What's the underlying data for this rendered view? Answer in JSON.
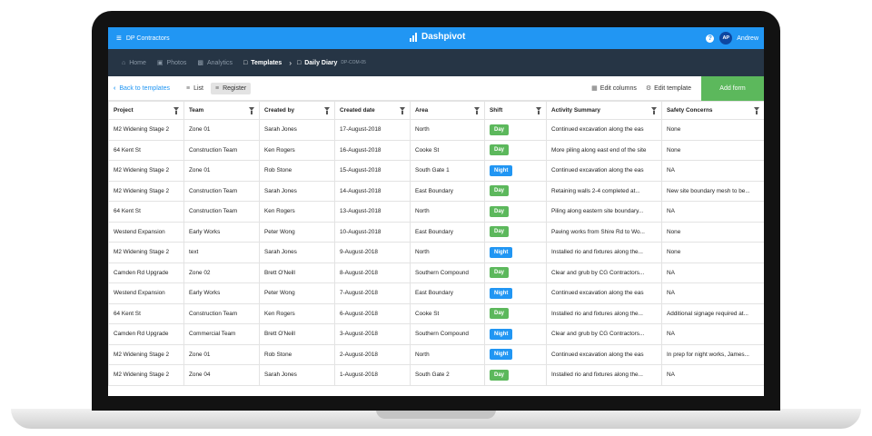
{
  "topbar": {
    "org": "DP Contractors",
    "brand": "Dashpivot",
    "help": "?",
    "avatar": "AP",
    "user": "Andrew"
  },
  "nav": {
    "home": "Home",
    "photos": "Photos",
    "analytics": "Analytics",
    "templates": "Templates",
    "current": "Daily Diary",
    "code": "DP-COM-05"
  },
  "toolbar": {
    "back": "Back to templates",
    "list": "List",
    "register": "Register",
    "edit_columns": "Edit columns",
    "edit_template": "Edit template",
    "add_form": "Add form"
  },
  "colors": {
    "day": "#5cb85c",
    "night": "#2196f3"
  },
  "table": {
    "headers": [
      "Project",
      "Team",
      "Created by",
      "Created date",
      "Area",
      "Shift",
      "Activity Summary",
      "Safety Concerns"
    ],
    "rows": [
      [
        "M2 Widening Stage 2",
        "Zone 01",
        "Sarah Jones",
        "17-August-2018",
        "North",
        "Day",
        "Continued excavation along the eas",
        "None"
      ],
      [
        "64 Kent St",
        "Construction Team",
        "Ken Rogers",
        "16-August-2018",
        "Cooke St",
        "Day",
        "More piling along east end of the site",
        "None"
      ],
      [
        "M2 Widening Stage 2",
        "Zone 01",
        "Rob Stone",
        "15-August-2018",
        "South Gate 1",
        "Night",
        "Continued excavation along the eas",
        "NA"
      ],
      [
        "M2 Widening Stage 2",
        "Construction Team",
        "Sarah Jones",
        "14-August-2018",
        "East Boundary",
        "Day",
        "Retaining walls 2-4 completed at...",
        "New site boundary mesh to be..."
      ],
      [
        "64 Kent St",
        "Construction Team",
        "Ken Rogers",
        "13-August-2018",
        "North",
        "Day",
        "Piling along eastern site boundary...",
        "NA"
      ],
      [
        "Westend Expansion",
        "Early Works",
        "Peter Wong",
        "10-August-2018",
        "East Boundary",
        "Day",
        "Paving works from Shire Rd to Wo...",
        "None"
      ],
      [
        "M2 Widening Stage 2",
        "text",
        "Sarah Jones",
        "9-August-2018",
        "North",
        "Night",
        "Installed rio and fixtures along the...",
        "None"
      ],
      [
        "Camden Rd Upgrade",
        "Zone 02",
        "Brett O'Neill",
        "8-August-2018",
        "Southern Compound",
        "Day",
        "Clear and grub by CG Contractors...",
        "NA"
      ],
      [
        "Westend Expansion",
        "Early Works",
        "Peter Wong",
        "7-August-2018",
        "East Boundary",
        "Night",
        "Continued excavation along the eas",
        "NA"
      ],
      [
        "64 Kent St",
        "Construction Team",
        "Ken Rogers",
        "6-August-2018",
        "Cooke St",
        "Day",
        "Installed rio and fixtures along the...",
        "Additional signage required at..."
      ],
      [
        "Camden Rd Upgrade",
        "Commercial Team",
        "Brett O'Neill",
        "3-August-2018",
        "Southern Compound",
        "Night",
        "Clear and grub by CG Contractors...",
        "NA"
      ],
      [
        "M2 Widening Stage 2",
        "Zone 01",
        "Rob Stone",
        "2-August-2018",
        "North",
        "Night",
        "Continued excavation along the eas",
        "In prep for night works, James..."
      ],
      [
        "M2 Widening Stage 2",
        "Zone 04",
        "Sarah Jones",
        "1-August-2018",
        "South Gate 2",
        "Day",
        "Installed rio and fixtures along the...",
        "NA"
      ]
    ]
  }
}
